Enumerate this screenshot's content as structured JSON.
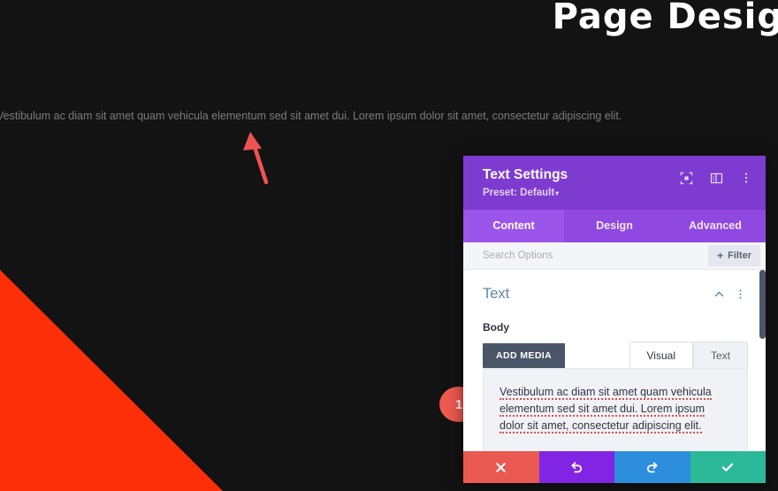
{
  "canvas": {
    "title": "Page Desig",
    "paragraph": "Vestibulum ac diam sit amet quam vehicula elementum sed sit amet dui. Lorem ipsum dolor sit amet, consectetur adipiscing elit.",
    "background_color": "#131313",
    "title_color": "#ffffff",
    "paragraph_color": "#7d7d7d",
    "triangle_color": "#fc2f08"
  },
  "annotations": {
    "arrow": {
      "icon": "up-arrow-annotation",
      "color": "#ef5350"
    },
    "step_badge": {
      "number": "1",
      "color": "#f05a50"
    }
  },
  "modal": {
    "title": "Text Settings",
    "preset_label": "Preset: Default",
    "preset_caret": "▾",
    "header_color": "#7e3bd0",
    "header_icons": [
      {
        "name": "expand-icon"
      },
      {
        "name": "panel-layout-icon"
      },
      {
        "name": "kebab-menu-icon"
      }
    ],
    "tabs": [
      {
        "label": "Content",
        "active": true
      },
      {
        "label": "Design",
        "active": false
      },
      {
        "label": "Advanced",
        "active": false
      }
    ],
    "search": {
      "placeholder": "Search Options",
      "value": ""
    },
    "filter": {
      "label": "Filter",
      "plus": "+"
    },
    "section": {
      "title": "Text",
      "collapse_icon": "chevron-up-icon",
      "menu_icon": "kebab-menu-icon"
    },
    "field": {
      "label": "Body",
      "add_media_label": "ADD MEDIA",
      "editor_tabs": [
        {
          "label": "Visual",
          "active": true
        },
        {
          "label": "Text",
          "active": false
        }
      ],
      "editor_content_line1": "Vestibulum ac diam sit amet quam vehicula",
      "editor_content_line2": "elementum sed sit amet dui. Lorem ipsum",
      "editor_content_line3": "dolor sit amet, consectetur adipiscing elit."
    },
    "footer_buttons": [
      {
        "name": "cancel-button",
        "icon": "close-icon",
        "color": "#ea5a52"
      },
      {
        "name": "undo-button",
        "icon": "undo-icon",
        "color": "#8224e3"
      },
      {
        "name": "redo-button",
        "icon": "redo-icon",
        "color": "#2d8ede"
      },
      {
        "name": "save-button",
        "icon": "check-icon",
        "color": "#2bb999"
      }
    ]
  }
}
